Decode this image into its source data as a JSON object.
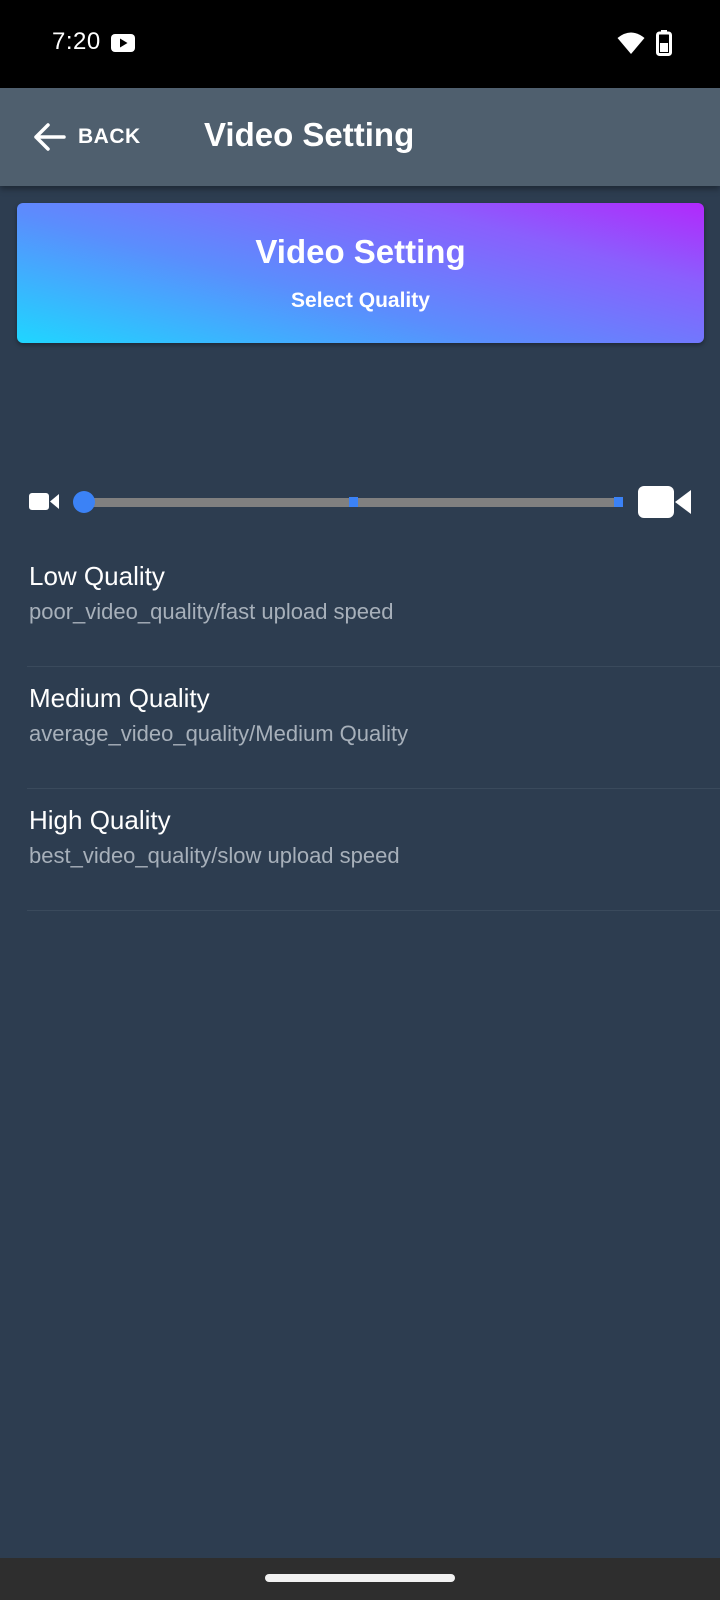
{
  "status_bar": {
    "time": "7:20",
    "icons": [
      "youtube-icon",
      "wifi-icon",
      "battery-icon"
    ]
  },
  "app_bar": {
    "back_label": "BACK",
    "title": "Video Setting"
  },
  "header_card": {
    "title": "Video Setting",
    "subtitle": "Select Quality",
    "gradient_colors": [
      "#1fd6ff",
      "#5b8dfd",
      "#8a5ffd",
      "#b228fc"
    ]
  },
  "quality_slider": {
    "min_icon": "video-camera-small-icon",
    "max_icon": "video-camera-large-icon",
    "steps": 3,
    "selected_index": 0,
    "accent_color": "#3b82f6"
  },
  "quality_options": [
    {
      "title": "Low Quality",
      "description": "poor_video_quality/fast upload speed"
    },
    {
      "title": "Medium Quality",
      "description": "average_video_quality/Medium Quality"
    },
    {
      "title": "High Quality",
      "description": "best_video_quality/slow upload speed"
    }
  ],
  "colors": {
    "background": "#2d3d50",
    "app_bar": "#4f5f6e",
    "status_bar": "#000000"
  }
}
